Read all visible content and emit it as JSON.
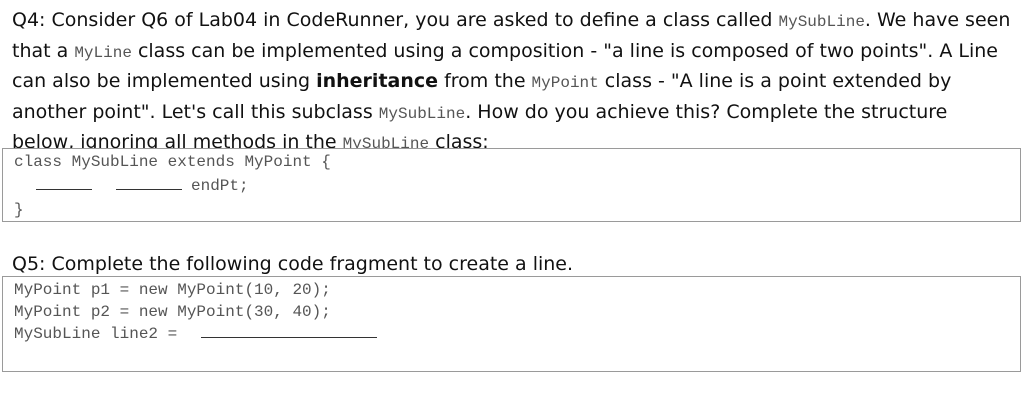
{
  "q4": {
    "p1": "Q4: Consider Q6 of Lab04 in CodeRunner, you are asked to define a class called ",
    "c1": "MySubLine",
    "p2": ". We have seen that a ",
    "c2": "MyLine",
    "p3": " class can be implemented using a composition - \"a line is composed of two points\". A Line can also be implemented using ",
    "b1": "inheritance",
    "p4": " from the ",
    "c3": "MyPoint",
    "p5": " class - \"A line is a point extended by another point\". Let's call this subclass ",
    "c4": "MySubLine",
    "p6": ". How do you achieve this? Complete the structure below, ignoring all methods in the ",
    "c5": "MySubLine",
    "p7": " class:",
    "code": {
      "line1": "class MySubLine extends MyPoint {",
      "line2_suffix": "endPt;",
      "line3": "}"
    }
  },
  "q5": {
    "text": "Q5: Complete the following code fragment to create a line.",
    "code": {
      "line1": "MyPoint p1 = new MyPoint(10, 20);",
      "line2": "MyPoint p2 = new MyPoint(30, 40);",
      "line3": "MySubLine line2 = "
    }
  }
}
